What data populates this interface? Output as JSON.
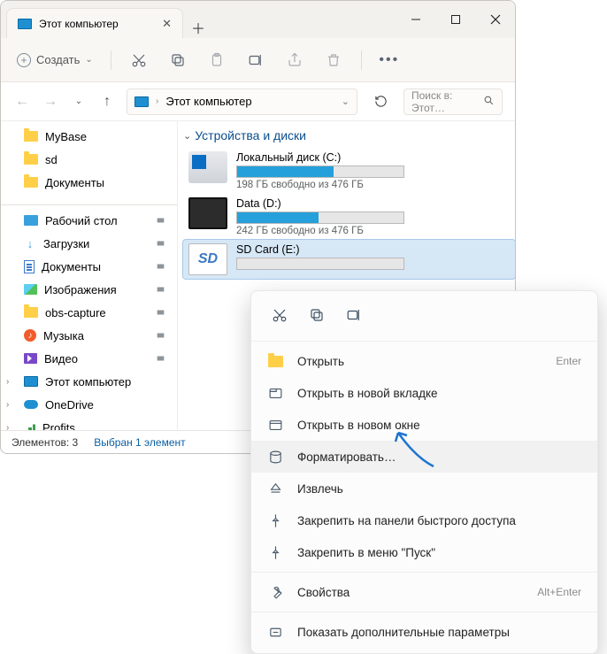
{
  "window": {
    "title": "Этот компьютер",
    "tabs": [
      {
        "label": "Этот компьютер"
      }
    ]
  },
  "toolbar": {
    "create": "Создать"
  },
  "address": {
    "path": "Этот компьютер",
    "search_placeholder": "Поиск в: Этот...",
    "search_ellipsis": "Поиск в: Этот…"
  },
  "nav": {
    "quick": [
      {
        "label": "MyBase"
      },
      {
        "label": "sd"
      },
      {
        "label": "Документы"
      }
    ],
    "pinned": [
      {
        "label": "Рабочий стол",
        "icon": "desktop"
      },
      {
        "label": "Загрузки",
        "icon": "download"
      },
      {
        "label": "Документы",
        "icon": "doc"
      },
      {
        "label": "Изображения",
        "icon": "image"
      },
      {
        "label": "obs-capture",
        "icon": "folder"
      },
      {
        "label": "Музыка",
        "icon": "music"
      },
      {
        "label": "Видео",
        "icon": "video"
      },
      {
        "label": "Этот компьютер",
        "icon": "pc"
      },
      {
        "label": "OneDrive",
        "icon": "cloud"
      },
      {
        "label": "Profits",
        "icon": "bar"
      }
    ]
  },
  "content": {
    "section": "Устройства и диски",
    "drives": [
      {
        "name": "Локальный диск (C:)",
        "free": "198 ГБ свободно из 476 ГБ",
        "fill": 58,
        "type": "win"
      },
      {
        "name": "Data (D:)",
        "free": "242 ГБ свободно из 476 ГБ",
        "fill": 49,
        "type": "data"
      },
      {
        "name": "SD Card (E:)",
        "free": "",
        "fill": 0,
        "type": "sd",
        "selected": true
      }
    ]
  },
  "status": {
    "count": "Элементов: 3",
    "selected": "Выбран 1 элемент"
  },
  "context": {
    "items": [
      {
        "label": "Открыть",
        "icon": "folder",
        "shortcut": "Enter"
      },
      {
        "label": "Открыть в новой вкладке",
        "icon": "tab"
      },
      {
        "label": "Открыть в новом окне",
        "icon": "window"
      },
      {
        "label": "Форматировать…",
        "icon": "format",
        "hover": true
      },
      {
        "label": "Извлечь",
        "icon": "eject"
      },
      {
        "label": "Закрепить на панели быстрого доступа",
        "icon": "pin"
      },
      {
        "label": "Закрепить в меню \"Пуск\"",
        "icon": "pin"
      },
      {
        "label": "Свойства",
        "icon": "wrench",
        "shortcut": "Alt+Enter"
      },
      {
        "label": "Показать дополнительные параметры",
        "icon": "more"
      }
    ]
  }
}
